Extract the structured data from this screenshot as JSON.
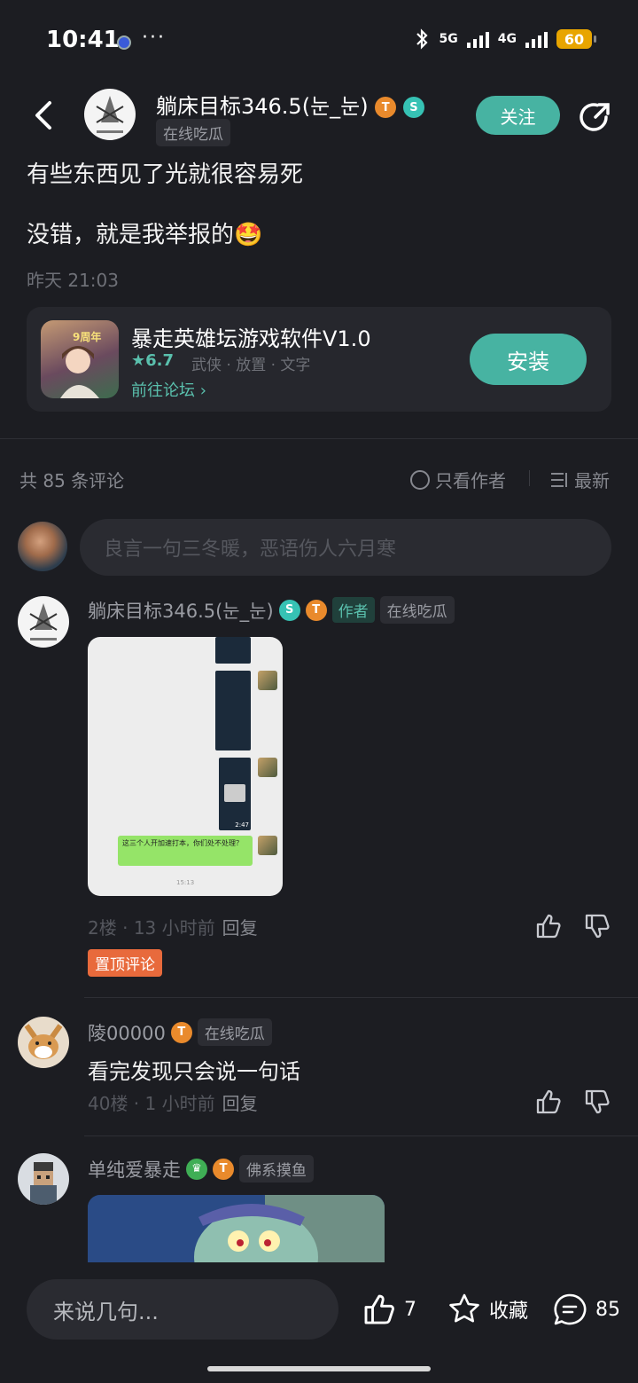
{
  "status_bar": {
    "time": "10:41",
    "net1": "5G",
    "net2": "4G",
    "battery": "60"
  },
  "header": {
    "author_name": "躺床目标346.5(눈_눈)",
    "author_status": "在线吃瓜",
    "badge_t_level": "7",
    "follow_label": "关注"
  },
  "post": {
    "line1": "有些东西见了光就很容易死",
    "line2": "没错，就是我举报的",
    "emoji": "🤩",
    "time": "昨天 21:03"
  },
  "app_card": {
    "title": "暴走英雄坛游戏软件V1.0",
    "rating": "6.7",
    "tags": "武侠 · 放置 · 文字",
    "forum_link": "前往论坛",
    "install_label": "安装",
    "icon_badge": "9周年"
  },
  "comments_header": {
    "count": "共 85 条评论",
    "only_author": "只看作者",
    "sort": "最新"
  },
  "comment_input": {
    "placeholder": "良言一句三冬暖，恶语伤人六月寒"
  },
  "comments": [
    {
      "name": "躺床目标346.5(눈_눈)",
      "t_level": "7",
      "author_tag": "作者",
      "status": "在线吃瓜",
      "image_text": "这三个人开加速打本，你们处不处理？",
      "image_time": "15:13",
      "video_time": "2:47",
      "floor": "2楼",
      "time": "13 小时前",
      "reply": "回复",
      "pin": "置顶评论"
    },
    {
      "name": "陵00000",
      "t_level": "6",
      "status": "在线吃瓜",
      "text": "看完发现只会说一句话",
      "floor": "40楼",
      "time": "1 小时前",
      "reply": "回复"
    },
    {
      "name": "单纯爱暴走",
      "t_level": "5",
      "status": "佛系摸鱼"
    }
  ],
  "bottom_bar": {
    "input_placeholder": "来说几句...",
    "likes": "7",
    "favorite": "收藏",
    "comments": "85"
  },
  "colors": {
    "accent": "#47b3a2",
    "background": "#1c1d22",
    "pin": "#e86a3c"
  }
}
